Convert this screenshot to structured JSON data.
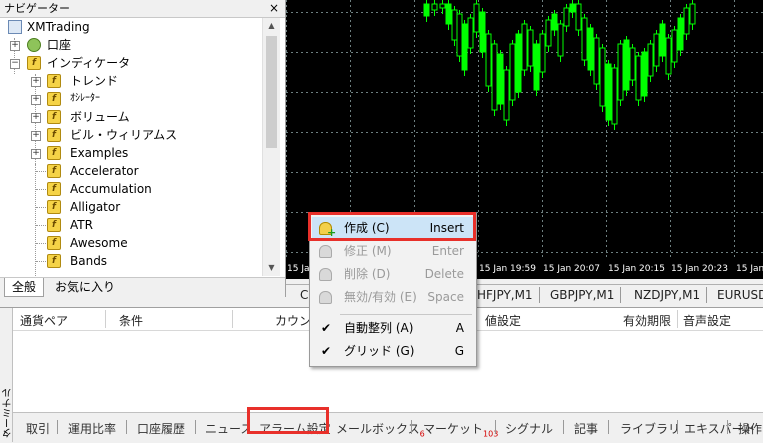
{
  "navigator": {
    "title": "ナビゲーター",
    "close_label": "×",
    "tree": [
      {
        "label": "XMTrading",
        "icon": "terminal-icon"
      },
      {
        "label": "口座",
        "icon": "accounts-icon"
      },
      {
        "label": "インディケータ",
        "icon": "indicator-folder-icon"
      },
      {
        "label": "トレンド",
        "icon": "indicator-folder-icon"
      },
      {
        "label": "ｵｼﾚｰﾀｰ",
        "icon": "indicator-folder-icon"
      },
      {
        "label": "ボリューム",
        "icon": "indicator-folder-icon"
      },
      {
        "label": "ビル・ウィリアムス",
        "icon": "indicator-folder-icon"
      },
      {
        "label": "Examples",
        "icon": "indicator-folder-icon"
      },
      {
        "label": "Accelerator",
        "icon": "indicator-icon"
      },
      {
        "label": "Accumulation",
        "icon": "indicator-icon"
      },
      {
        "label": "Alligator",
        "icon": "indicator-icon"
      },
      {
        "label": "ATR",
        "icon": "indicator-icon"
      },
      {
        "label": "Awesome",
        "icon": "indicator-icon"
      },
      {
        "label": "Bands",
        "icon": "indicator-icon"
      }
    ],
    "tabs": [
      "全般",
      "お気に入り"
    ]
  },
  "chart": {
    "time_labels": [
      "15 Jan",
      "15 Jan 19:59",
      "15 Jan 20:07",
      "15 Jan 20:15",
      "15 Jan 20:23",
      "15 Jan"
    ],
    "colors": {
      "background": "#000000",
      "candle": "#00ff00",
      "grid": "#6e7f80"
    }
  },
  "symbol_tabs": [
    "C",
    "HFJPY,M1",
    "GBPJPY,M1",
    "NZDJPY,M1",
    "EURUSD"
  ],
  "terminal": {
    "side_title": "ターミナル",
    "columns": [
      "通貨ペア",
      "条件",
      "カウンタ",
      "値設定",
      "有効期限",
      "音声設定"
    ],
    "tabs": [
      {
        "label": "取引",
        "badge": ""
      },
      {
        "label": "運用比率",
        "badge": ""
      },
      {
        "label": "口座履歴",
        "badge": ""
      },
      {
        "label": "ニュース",
        "badge": ""
      },
      {
        "label": "アラーム設定",
        "badge": ""
      },
      {
        "label": "メールボックス",
        "badge": "6"
      },
      {
        "label": "マーケット",
        "badge": "103"
      },
      {
        "label": "シグナル",
        "badge": ""
      },
      {
        "label": "記事",
        "badge": ""
      },
      {
        "label": "ライブラリ",
        "badge": ""
      },
      {
        "label": "エキスパート",
        "badge": ""
      },
      {
        "label": "操作",
        "badge": ""
      }
    ],
    "active_tab": "アラーム設定"
  },
  "context_menu": {
    "items": [
      {
        "label": "作成 (C)",
        "shortcut": "Insert",
        "enabled": true,
        "selected": true
      },
      {
        "label": "修正 (M)",
        "shortcut": "Enter",
        "enabled": false
      },
      {
        "label": "削除 (D)",
        "shortcut": "Delete",
        "enabled": false
      },
      {
        "label": "無効/有効 (E)",
        "shortcut": "Space",
        "enabled": false
      },
      {
        "label": "自動整列 (A)",
        "shortcut": "A",
        "enabled": true,
        "checked": true
      },
      {
        "label": "グリッド (G)",
        "shortcut": "G",
        "enabled": true,
        "checked": true
      }
    ]
  },
  "highlight_color": "#e8302a"
}
